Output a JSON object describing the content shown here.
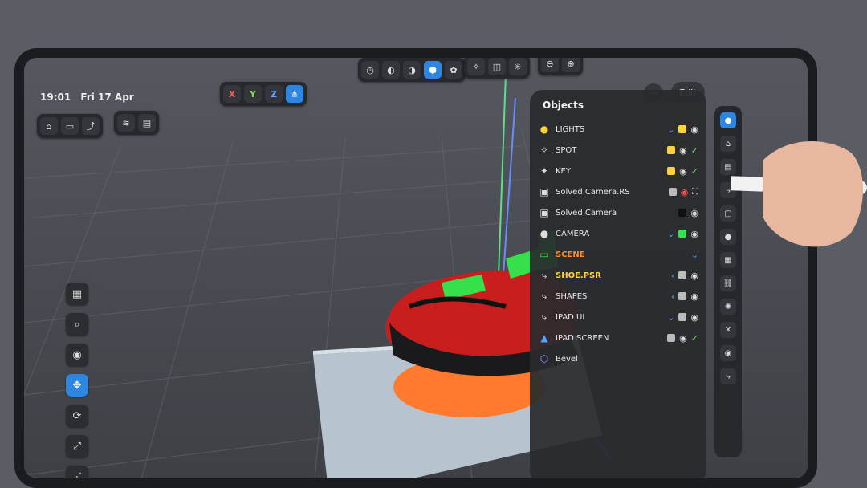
{
  "status": {
    "time": "19:01",
    "date": "Fri 17 Apr"
  },
  "axis_toolbar": {
    "x": "X",
    "y": "Y",
    "z": "Z"
  },
  "panel": {
    "title": "Objects",
    "edit_label": "Edit",
    "items": [
      {
        "label": "LIGHTS",
        "style": "normal"
      },
      {
        "label": "SPOT",
        "style": "normal"
      },
      {
        "label": "KEY",
        "style": "normal"
      },
      {
        "label": "Solved Camera.RS",
        "style": "normal"
      },
      {
        "label": "Solved Camera",
        "style": "normal"
      },
      {
        "label": "CAMERA",
        "style": "normal"
      },
      {
        "label": "SCENE",
        "style": "orange"
      },
      {
        "label": "SHOE.PSR",
        "style": "yellow"
      },
      {
        "label": "SHAPES",
        "style": "normal"
      },
      {
        "label": "IPAD UI",
        "style": "normal"
      },
      {
        "label": "IPAD SCREEN",
        "style": "normal"
      },
      {
        "label": "Bevel",
        "style": "normal"
      }
    ]
  },
  "icons": {
    "home": "home-icon",
    "folder": "folder-icon",
    "export": "export-icon",
    "wifi": "wifi-icon",
    "document": "document-icon"
  },
  "colors": {
    "accent": "#2f86e0",
    "scene_label": "#ff8a2a",
    "shoe_label": "#ffd23a",
    "platform": "#ff7a2e",
    "shoe_primary": "#c81e1e",
    "shoe_accent": "#35e04a"
  }
}
